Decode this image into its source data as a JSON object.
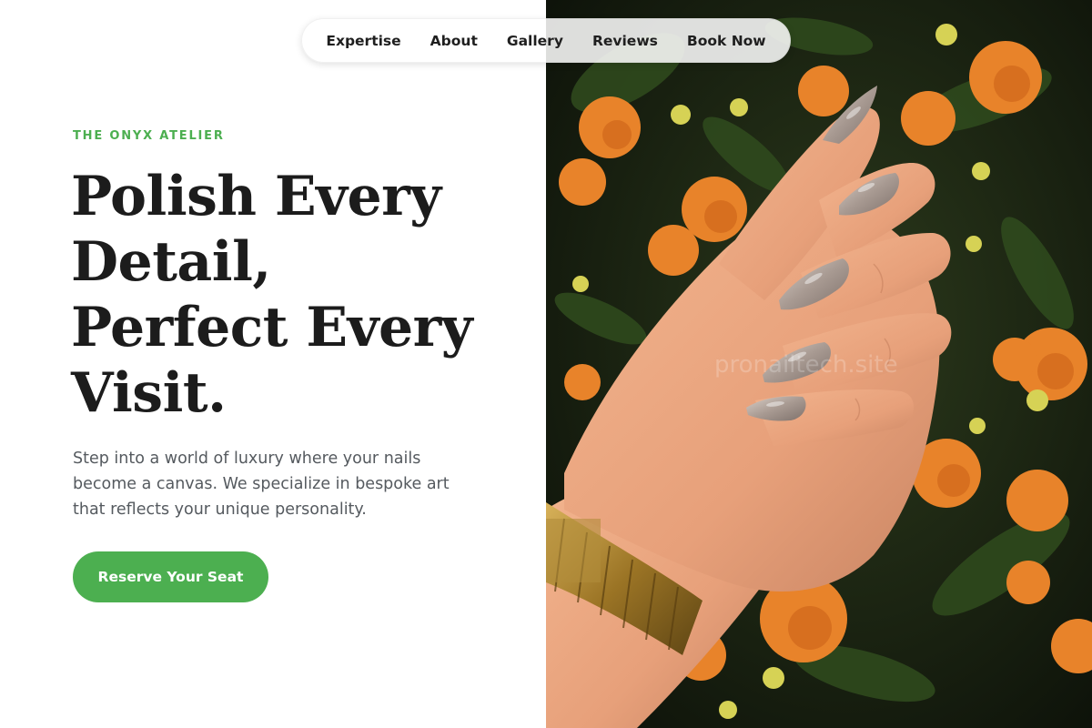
{
  "nav": {
    "items": [
      {
        "label": "Expertise"
      },
      {
        "label": "About"
      },
      {
        "label": "Gallery"
      },
      {
        "label": "Reviews"
      },
      {
        "label": "Book Now"
      }
    ]
  },
  "hero": {
    "eyebrow": "THE ONYX ATELIER",
    "headline_lines": [
      "Polish Every",
      "Detail,",
      "Perfect Every",
      "Visit."
    ],
    "subtext": "Step into a world of luxury where your nails become a canvas. We specialize in bespoke art that reflects your unique personality.",
    "cta_label": "Reserve Your Seat"
  },
  "photo": {
    "watermark": "pronailtech.site"
  },
  "colors": {
    "accent": "#4caf50",
    "heading": "#1c1c1c",
    "body_text": "#555a5f",
    "flowers": "#e8832a",
    "nail_polish": "#a89a92"
  }
}
